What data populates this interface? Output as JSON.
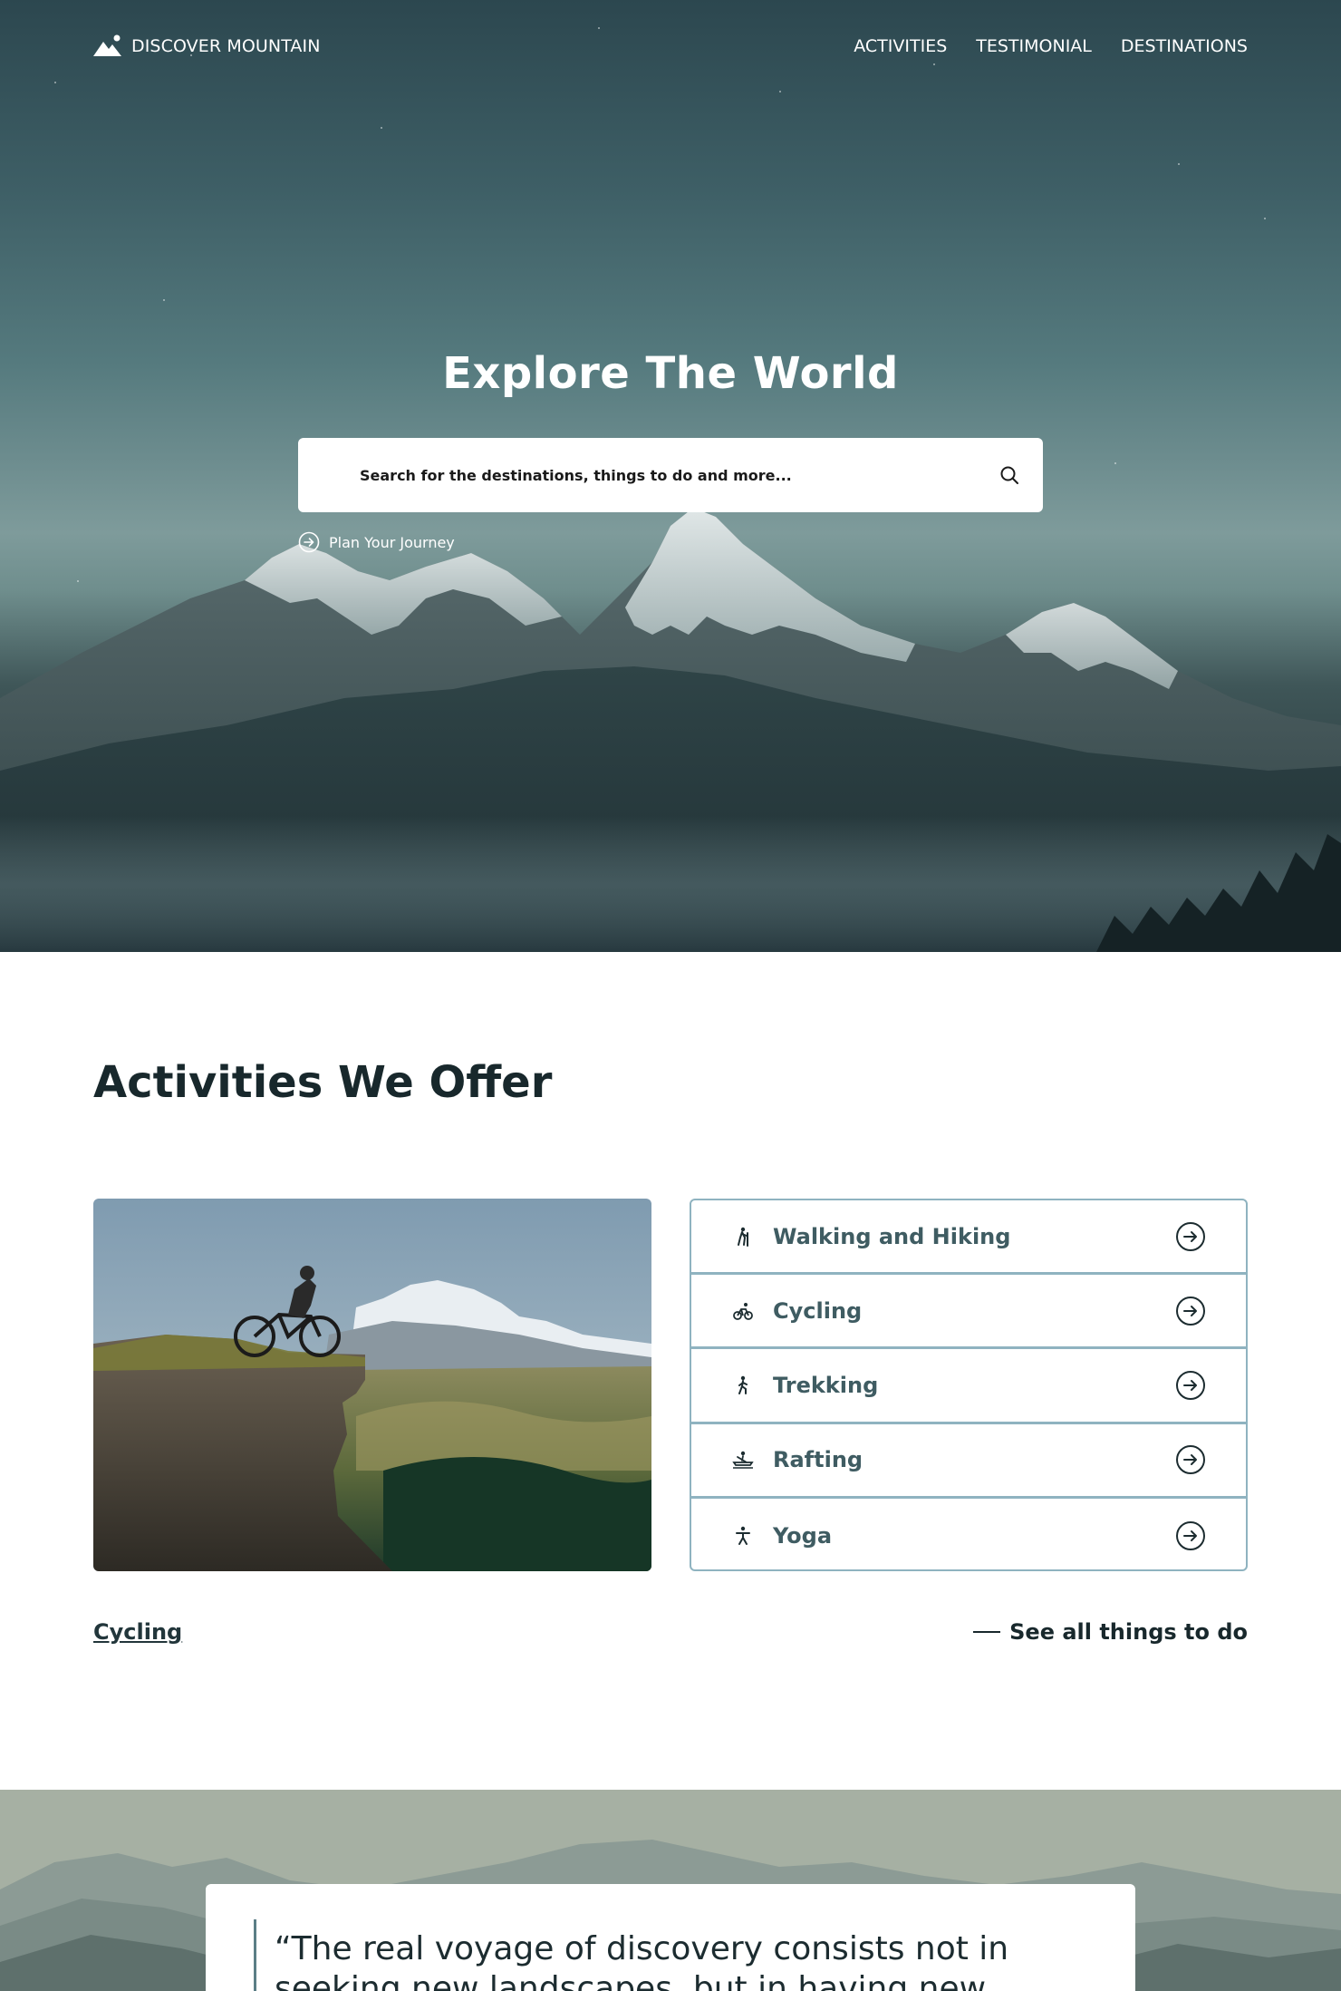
{
  "colors": {
    "accent": "#8fb3c0",
    "text_dark": "#18282c",
    "activity_text": "#3f5c62",
    "hero_sky": "#557a7e"
  },
  "nav": {
    "brand": "DISCOVER MOUNTAIN",
    "brand_icon": "mountain-icon",
    "links": [
      "ACTIVITIES",
      "TESTIMONIAL",
      "DESTINATIONS"
    ]
  },
  "hero": {
    "title": "Explore The World",
    "search_placeholder": "Search for the destinations, things to do and more...",
    "search_icon": "search-icon",
    "plan_label": "Plan Your Journey",
    "plan_icon": "arrow-circle-icon"
  },
  "activities": {
    "title": "Activities We Offer",
    "image_subject": "cyclist-on-cliff",
    "items": [
      {
        "label": "Walking and Hiking",
        "icon": "hiking-icon"
      },
      {
        "label": "Cycling",
        "icon": "cycling-icon"
      },
      {
        "label": "Trekking",
        "icon": "trekking-icon"
      },
      {
        "label": "Rafting",
        "icon": "rafting-icon"
      },
      {
        "label": "Yoga",
        "icon": "yoga-icon"
      }
    ],
    "selected_label": "Cycling",
    "see_all_label": "See all things to do"
  },
  "testimonial": {
    "quote": "“The real voyage of discovery consists not in seeking new landscapes, but in having new eyes.”"
  }
}
